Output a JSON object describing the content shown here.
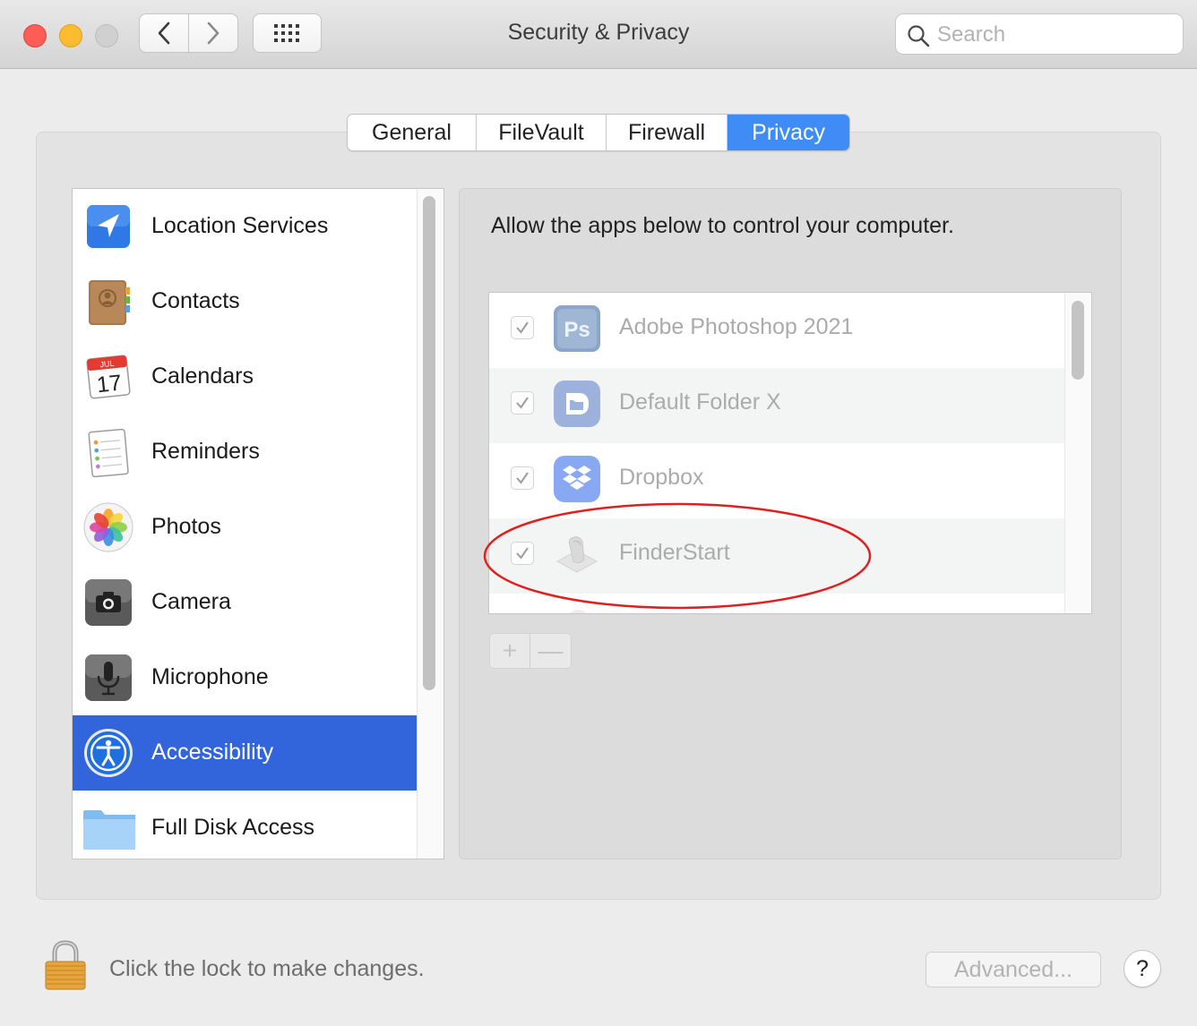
{
  "window": {
    "title": "Security & Privacy"
  },
  "search": {
    "placeholder": "Search"
  },
  "tabs": [
    {
      "label": "General",
      "active": false
    },
    {
      "label": "FileVault",
      "active": false
    },
    {
      "label": "Firewall",
      "active": false
    },
    {
      "label": "Privacy",
      "active": true
    }
  ],
  "sidebar": {
    "items": [
      {
        "label": "Location Services",
        "icon": "location-arrow-icon"
      },
      {
        "label": "Contacts",
        "icon": "contacts-book-icon"
      },
      {
        "label": "Calendars",
        "icon": "calendar-icon",
        "icon_month": "JUL",
        "icon_day": "17"
      },
      {
        "label": "Reminders",
        "icon": "reminders-icon"
      },
      {
        "label": "Photos",
        "icon": "photos-flower-icon"
      },
      {
        "label": "Camera",
        "icon": "camera-icon"
      },
      {
        "label": "Microphone",
        "icon": "microphone-icon"
      },
      {
        "label": "Accessibility",
        "icon": "accessibility-icon",
        "selected": true
      },
      {
        "label": "Full Disk Access",
        "icon": "folder-icon"
      }
    ]
  },
  "main": {
    "description": "Allow the apps below to control your computer.",
    "apps": [
      {
        "name": "Adobe Photoshop 2021",
        "checked": true,
        "icon": "photoshop-icon",
        "icon_text": "Ps"
      },
      {
        "name": "Default Folder X",
        "checked": true,
        "icon": "default-folder-x-icon"
      },
      {
        "name": "Dropbox",
        "checked": true,
        "icon": "dropbox-icon"
      },
      {
        "name": "FinderStart",
        "checked": true,
        "icon": "finderstart-icon"
      }
    ],
    "add_label": "+",
    "remove_label": "—"
  },
  "footer": {
    "lock_text": "Click the lock to make changes.",
    "advanced_label": "Advanced...",
    "help_label": "?"
  },
  "colors": {
    "accent": "#3f8cf6",
    "selection": "#3265dc",
    "annotation": "#e0201f"
  }
}
